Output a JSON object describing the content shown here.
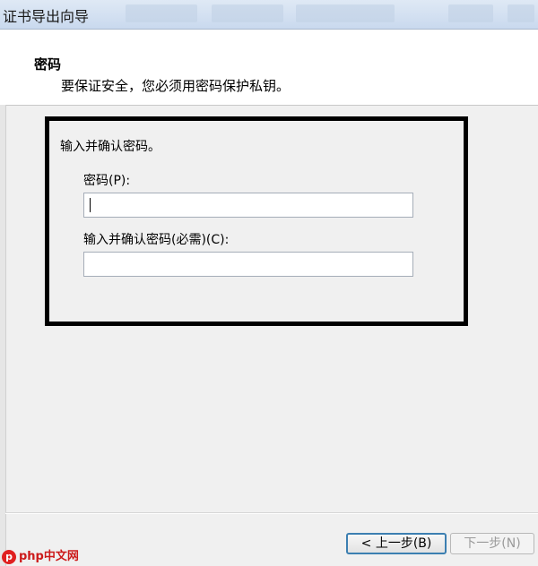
{
  "window": {
    "title": "证书导出向导"
  },
  "header": {
    "title": "密码",
    "subtitle": "要保证安全，您必须用密码保护私钥。"
  },
  "form": {
    "instruction": "输入并确认密码。",
    "password_label": "密码(P):",
    "password_value": "",
    "confirm_label": "输入并确认密码(必需)(C):",
    "confirm_value": ""
  },
  "footer": {
    "back_label": "< 上一步(B)",
    "next_label": "下一步(N)"
  },
  "watermark": {
    "text": "php中文网"
  }
}
